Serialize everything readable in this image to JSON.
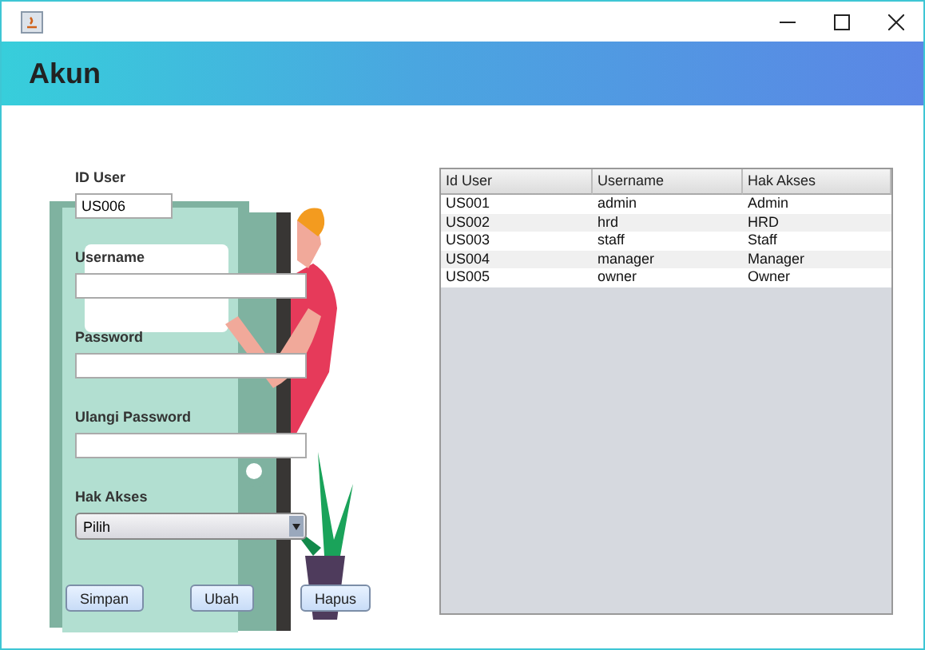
{
  "header": {
    "title": "Akun"
  },
  "form": {
    "fields": [
      {
        "label": "ID User",
        "kind": "short_text",
        "value": "US006"
      },
      {
        "label": "Username",
        "kind": "text"
      },
      {
        "label": "Password",
        "kind": "text"
      },
      {
        "label": "Ulangi Password",
        "kind": "text"
      },
      {
        "label": "Hak Akses",
        "kind": "combo",
        "value": "Pilih"
      }
    ],
    "buttons": [
      "Simpan",
      "Ubah",
      "Hapus"
    ]
  },
  "table": {
    "columns": [
      "Id User",
      "Username",
      "Hak Akses"
    ],
    "rows": [
      [
        "US001",
        "admin",
        "Admin"
      ],
      [
        "US002",
        "hrd",
        "HRD"
      ],
      [
        "US003",
        "staff",
        "Staff"
      ],
      [
        "US004",
        "manager",
        "Manager"
      ],
      [
        "US005",
        "owner",
        "Owner"
      ]
    ]
  }
}
